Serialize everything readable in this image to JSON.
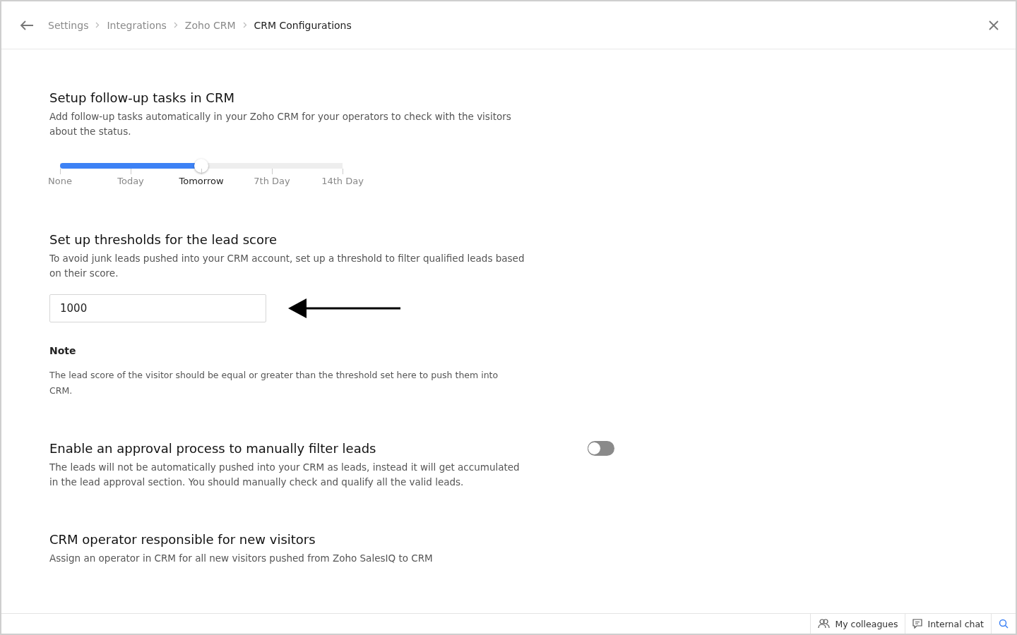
{
  "breadcrumb": {
    "items": [
      {
        "label": "Settings"
      },
      {
        "label": "Integrations"
      },
      {
        "label": "Zoho CRM"
      }
    ],
    "current": "CRM Configurations"
  },
  "sections": [
    {
      "kind": "slider",
      "title": "Setup follow-up tasks in CRM",
      "description": "Add follow-up tasks automatically in your Zoho CRM for your operators to check with the visitors about the status.",
      "level": 0.5,
      "stops": [
        {
          "label": "None",
          "selected": false
        },
        {
          "label": "Today",
          "selected": false
        },
        {
          "label": "Tomorrow",
          "selected": true
        },
        {
          "label": "7th Day",
          "selected": false
        },
        {
          "label": "14th Day",
          "selected": false
        }
      ]
    },
    {
      "kind": "input",
      "title": "Set up thresholds for the lead score",
      "description": "To avoid junk leads pushed into your CRM account, set up a threshold to filter qualified leads based on their score.",
      "value": "1000",
      "note_title": "Note",
      "note": "The lead score of the visitor should be equal or greater than the threshold set here to push them into CRM."
    },
    {
      "kind": "toggle",
      "title": "Enable an approval process to manually filter leads",
      "description": "The leads will not be automatically pushed into your CRM as leads, instead it will get accumulated in the lead approval section. You should manually check and qualify all the valid leads.",
      "on": false
    },
    {
      "kind": "text",
      "title": "CRM operator responsible for new visitors",
      "description": "Assign an operator in CRM for all new visitors pushed from Zoho SalesIQ to CRM"
    }
  ],
  "footer": {
    "items": [
      {
        "label": "My colleagues"
      },
      {
        "label": "Internal chat"
      }
    ]
  }
}
